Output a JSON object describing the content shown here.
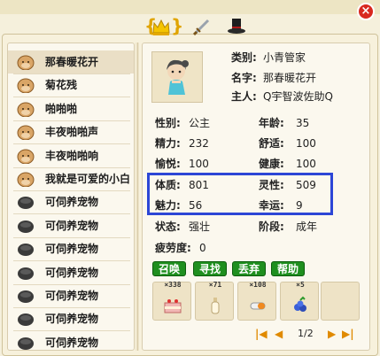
{
  "window": {
    "close_icon": "close-icon",
    "tabs": [
      {
        "icon": "crown-icon",
        "active": true
      },
      {
        "icon": "sword-icon",
        "active": false
      },
      {
        "icon": "hat-icon",
        "active": false
      }
    ]
  },
  "pet_list": [
    {
      "name": "那春暖花开",
      "icon": "bald-head-icon",
      "selected": true
    },
    {
      "name": "菊花残",
      "icon": "bald-head-icon",
      "selected": false
    },
    {
      "name": "啪啪啪",
      "icon": "bald-head-icon",
      "selected": false
    },
    {
      "name": "丰夜啪啪声",
      "icon": "bald-head-icon",
      "selected": false
    },
    {
      "name": "丰夜啪啪响",
      "icon": "bald-head-icon",
      "selected": false
    },
    {
      "name": "我就是可爱的小白",
      "icon": "bald-head-icon",
      "selected": false
    },
    {
      "name": "可伺养宠物",
      "icon": "empty-slot-icon",
      "selected": false
    },
    {
      "name": "可伺养宠物",
      "icon": "empty-slot-icon",
      "selected": false
    },
    {
      "name": "可伺养宠物",
      "icon": "empty-slot-icon",
      "selected": false
    },
    {
      "name": "可伺养宠物",
      "icon": "empty-slot-icon",
      "selected": false
    },
    {
      "name": "可伺养宠物",
      "icon": "empty-slot-icon",
      "selected": false
    },
    {
      "name": "可伺养宠物",
      "icon": "empty-slot-icon",
      "selected": false
    },
    {
      "name": "可伺养宠物",
      "icon": "empty-slot-icon",
      "selected": false
    }
  ],
  "profile": {
    "type_label": "类别:",
    "type_value": "小青管家",
    "name_label": "名字:",
    "name_value": "那春暖花开",
    "owner_label": "主人:",
    "owner_value": "Q宇智波佐助Q"
  },
  "stats": {
    "gender_label": "性别:",
    "gender_value": "公主",
    "age_label": "年龄:",
    "age_value": "35",
    "energy_label": "精力:",
    "energy_value": "232",
    "comfort_label": "舒适:",
    "comfort_value": "100",
    "joy_label": "愉悦:",
    "joy_value": "100",
    "health_label": "健康:",
    "health_value": "100",
    "physique_label": "体质:",
    "physique_value": "801",
    "spirit_label": "灵性:",
    "spirit_value": "509",
    "charm_label": "魅力:",
    "charm_value": "56",
    "luck_label": "幸运:",
    "luck_value": "9",
    "state_label": "状态:",
    "state_value": "强壮",
    "stage_label": "阶段:",
    "stage_value": "成年",
    "fatigue_label": "疲劳度:",
    "fatigue_value": "0"
  },
  "buttons": {
    "summon": "召唤",
    "find": "寻找",
    "discard": "丢弃",
    "help": "帮助"
  },
  "items": [
    {
      "count": "×338",
      "icon": "cake-icon"
    },
    {
      "count": "×71",
      "icon": "bottle-icon"
    },
    {
      "count": "×108",
      "icon": "pill-icon"
    },
    {
      "count": "×5",
      "icon": "blueberry-icon"
    },
    {
      "count": "",
      "icon": "empty-icon"
    }
  ],
  "pager": {
    "page_text": "1/2",
    "first_icon": "first-page-icon",
    "prev_icon": "prev-page-icon",
    "next_icon": "next-page-icon",
    "last_icon": "last-page-icon"
  },
  "colors": {
    "highlight_border": "#2c46d6",
    "button_green": "#1f8f1f",
    "close_red": "#d8281f",
    "pager_orange": "#e08a00"
  }
}
